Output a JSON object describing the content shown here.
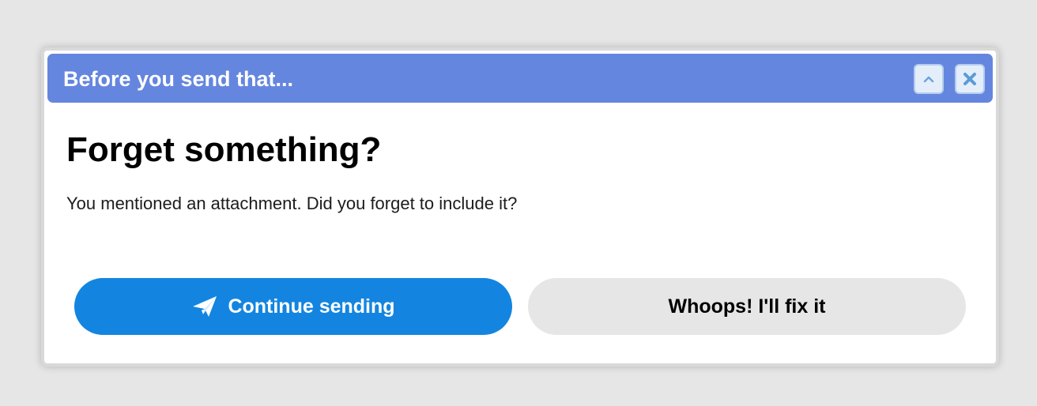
{
  "dialog": {
    "title": "Before you send that...",
    "heading": "Forget something?",
    "message": "You mentioned an attachment. Did you forget to include it?",
    "buttons": {
      "continue_label": "Continue sending",
      "fix_label": "Whoops! I'll fix it"
    },
    "titlebar_controls": {
      "collapse_icon": "chevron-up-icon",
      "close_icon": "close-icon"
    }
  },
  "colors": {
    "titlebar": "#6586df",
    "primary_button": "#1385e0",
    "secondary_button": "#e6e6e6",
    "background": "#e6e6e6"
  },
  "icons": {
    "continue_button": "paper-plane-icon"
  }
}
